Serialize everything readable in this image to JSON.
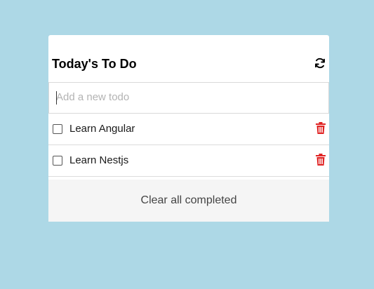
{
  "header": {
    "title": "Today's To Do",
    "refresh_icon": "refresh-icon"
  },
  "new_todo": {
    "placeholder": "Add a new todo",
    "value": ""
  },
  "todos": [
    {
      "label": "Learn Angular",
      "completed": false,
      "delete_icon": "trash-icon"
    },
    {
      "label": "Learn Nestjs",
      "completed": false,
      "delete_icon": "trash-icon"
    }
  ],
  "footer": {
    "clear_label": "Clear all completed"
  },
  "colors": {
    "background": "#add8e6",
    "card": "#ffffff",
    "footer": "#f5f5f5",
    "delete": "#e02424"
  }
}
